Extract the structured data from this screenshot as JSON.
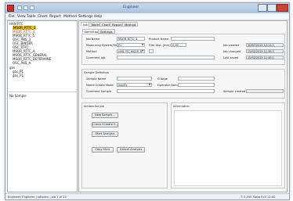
{
  "titlebar": {
    "title": "Engineer"
  },
  "menu": [
    "File",
    "View",
    "Table",
    "Chart",
    "Report",
    "Method",
    "Settings",
    "Help"
  ],
  "tree": {
    "nodes": [
      {
        "label": "HAN PTC",
        "style": "normal"
      },
      {
        "label": "MSOR_RTTC_3",
        "style": "selected"
      },
      {
        "label": "MSOR_RTTC_4",
        "style": "normal"
      },
      {
        "label": "MSOR_RTTC_5",
        "style": "normal"
      },
      {
        "label": "OSC_PHS_3",
        "style": "normal"
      },
      {
        "label": "OSC_BINDER",
        "style": "normal"
      },
      {
        "label": "OSC_RTTC",
        "style": "normal"
      },
      {
        "label": "MSOR_RTTC_A",
        "style": "normal"
      },
      {
        "label": "MSOR_RTTC_GENERAL",
        "style": "normal"
      },
      {
        "label": "MSOR_RTTC_DETERMINE",
        "style": "normal"
      },
      {
        "label": "OSC_PHS_H",
        "style": "normal"
      },
      {
        "label": "gas",
        "style": "normal"
      },
      {
        "label": "gas_P1",
        "style": "normal"
      },
      {
        "label": "gas_P1",
        "style": "normal"
      }
    ],
    "bottom_label": "No Sample"
  },
  "tabs": [
    "Job",
    "Tables",
    "Chart",
    "Report",
    "Method"
  ],
  "subtabs": [
    "Definition",
    "Settings"
  ],
  "job_def": {
    "job_name_label": "Job Name",
    "job_name_value": "MSOR_RTTC_3",
    "measuring_label": "Measuring System/Rheometer",
    "measuring_value": "P1",
    "method_label": "Method",
    "method_value": "HAN PTC  MSOR_R",
    "comment_label": "Comment Job",
    "product_label": "Product Name",
    "film_label": "Film Dist. [mm]:",
    "film_value": "0.00",
    "created_label": "Job created",
    "created_value": "30/07/2019 12:11:3",
    "changed_label": "Job changed",
    "changed_value": "15/02/2019 11:39:3",
    "saved_label": "Last saved",
    "saved_value": "15/02/2019 11:40:1"
  },
  "sample_def": {
    "header": "Sample Definition",
    "sample_name_label": "Sample Name",
    "name_create_label": "Name Create Mode",
    "name_create_value": "modify",
    "comment_label": "Comment Sample",
    "charge_label": "Charge",
    "operator_label": "Operator Name",
    "sample_created_label": "Sample created"
  },
  "actions": {
    "header": "Actions for Job",
    "new_sample": "New Sample...",
    "check_create": "Check+Create S...",
    "start_analysis": "Start Analysis",
    "copy_start": "Copy Start",
    "cancel_analysis": "Cancel Analysis"
  },
  "information": {
    "header": "Information"
  },
  "statusbar": {
    "left": "Engineer: Engineer  | rollsdev - Job 1 of 12",
    "right": "T: 0,000  State Ex3  12:00"
  }
}
